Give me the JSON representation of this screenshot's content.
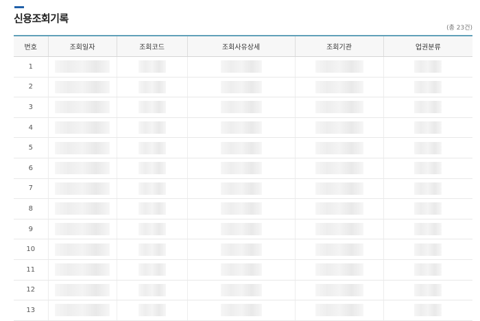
{
  "header": {
    "title": "신용조회기록",
    "total_count": "(총 23건)"
  },
  "table": {
    "columns": [
      "번호",
      "조회일자",
      "조회코드",
      "조회사유상세",
      "조회기관",
      "업권분류"
    ],
    "row_numbers": [
      "1",
      "2",
      "3",
      "4",
      "5",
      "6",
      "7",
      "8",
      "9",
      "10",
      "11",
      "12",
      "13"
    ]
  },
  "colors": {
    "accent": "#1f5fa8",
    "header_border": "#5f9fb8"
  }
}
